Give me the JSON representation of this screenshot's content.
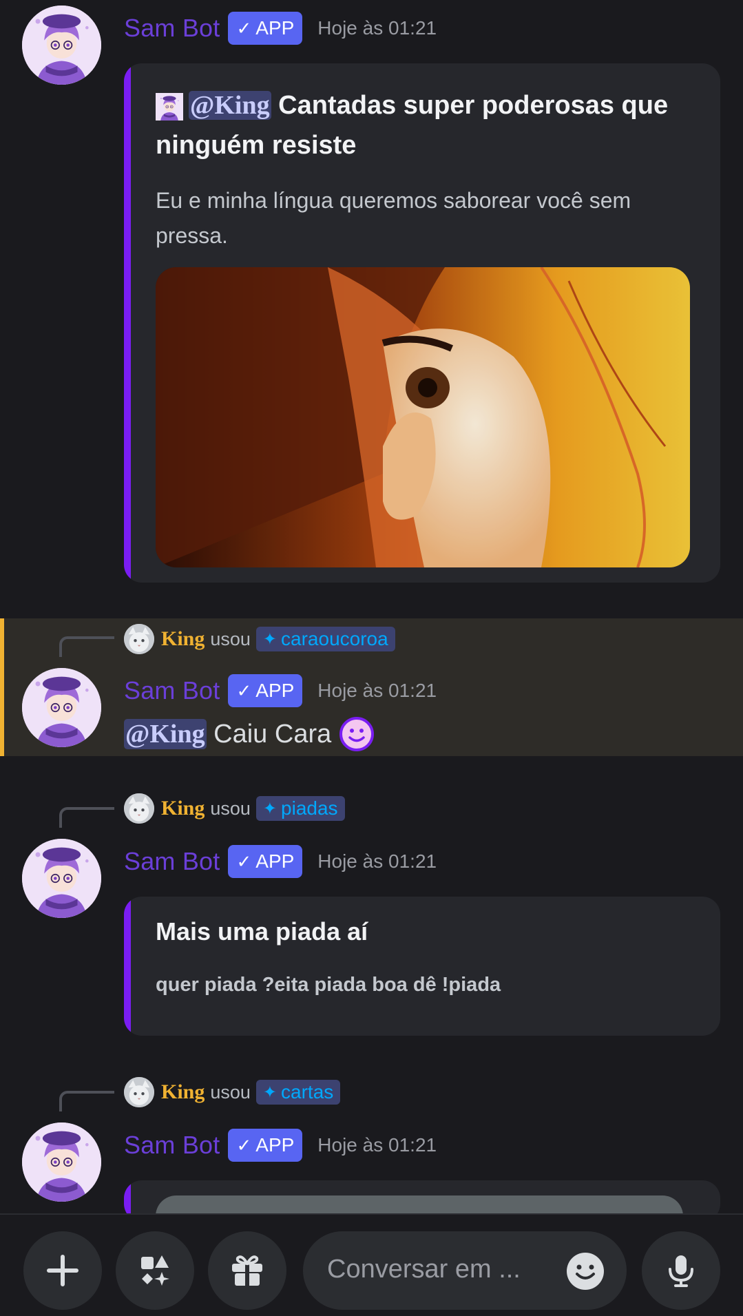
{
  "bot": {
    "name": "Sam Bot",
    "badge": "APP",
    "badge_check": "✓"
  },
  "messages": [
    {
      "timestamp": "Hoje às 01:21",
      "embed": {
        "mention": "@King",
        "title_rest": " Cantadas super poderosas que ninguém resiste",
        "description": "Eu e minha língua queremos saborear você sem pressa."
      }
    },
    {
      "reply": {
        "user": "King",
        "used": "usou",
        "command": "caraoucoroa"
      },
      "timestamp": "Hoje às 01:21",
      "mention": "@King",
      "text": " Caiu Cara "
    },
    {
      "reply": {
        "user": "King",
        "used": "usou",
        "command": "piadas"
      },
      "timestamp": "Hoje às 01:21",
      "embed": {
        "title": "Mais uma piada aí",
        "description": "quer piada ?eita piada boa dê !piada"
      }
    },
    {
      "reply": {
        "user": "King",
        "used": "usou",
        "command": "cartas"
      },
      "timestamp": "Hoje às 01:21"
    }
  ],
  "composer": {
    "placeholder": "Conversar em ..."
  },
  "colors": {
    "accent": "#7a1df2",
    "username": "#6b3fd8",
    "badge": "#5865f2",
    "highlight": "#f0b232"
  },
  "icons": [
    "plus-icon",
    "apps-icon",
    "gift-icon",
    "emoji-icon",
    "microphone-icon",
    "smiley-emoji-icon"
  ]
}
